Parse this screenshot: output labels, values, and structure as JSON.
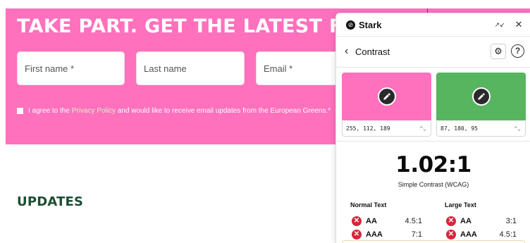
{
  "website": {
    "headline": "TAKE PART. GET THE LATEST FRO",
    "fields": {
      "first_name": "First name *",
      "last_name": "Last name",
      "email": "Email *"
    },
    "consent": {
      "before": "I agree to the",
      "link": "Privacy Policy",
      "after": "and would like to receive email updates from the European Greens.*"
    },
    "updates_heading": "UPDATES",
    "colors": {
      "band": "#ff70bd",
      "heading": "#1c4d32"
    }
  },
  "stark": {
    "app_title": "Stark",
    "logo_glyph": "⊘",
    "collapse_glyph": "↗↙",
    "close_glyph": "✕",
    "back_glyph": "‹",
    "nav_title": "Contrast",
    "settings_glyph": "⚙",
    "help_glyph": "?",
    "foreground": {
      "value": "255, 112, 189",
      "color": "#ff70bd"
    },
    "background": {
      "value": "87, 180, 95",
      "color": "#57b45f"
    },
    "stepper_glyph": "⌃⌄",
    "ratio": "1.02:1",
    "ratio_label": "Simple Contrast (WCAG)",
    "normal_text": {
      "heading": "Normal Text",
      "aa": {
        "level": "AA",
        "ratio": "4.5:1"
      },
      "aaa": {
        "level": "AAA",
        "ratio": "7:1"
      }
    },
    "large_text": {
      "heading": "Large Text",
      "aa": {
        "level": "AA",
        "ratio": "3:1"
      },
      "aaa": {
        "level": "AAA",
        "ratio": "4.5:1"
      }
    },
    "fail_glyph": "✕"
  }
}
